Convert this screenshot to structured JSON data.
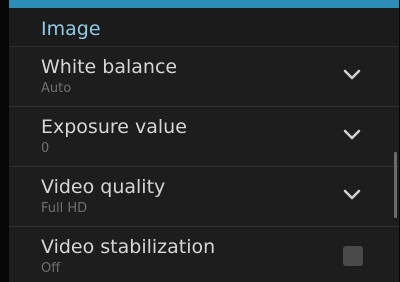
{
  "section": {
    "title": "Image"
  },
  "rows": [
    {
      "title": "White balance",
      "value": "Auto",
      "control": "chevron-down"
    },
    {
      "title": "Exposure value",
      "value": "0",
      "control": "chevron-down"
    },
    {
      "title": "Video quality",
      "value": "Full HD",
      "control": "chevron-down"
    },
    {
      "title": "Video stabilization",
      "value": "Off",
      "control": "checkbox",
      "checked": false
    }
  ],
  "colors": {
    "accent": "#2c8db5",
    "header_text": "#8ecbe8",
    "background": "#1d1d1d"
  }
}
